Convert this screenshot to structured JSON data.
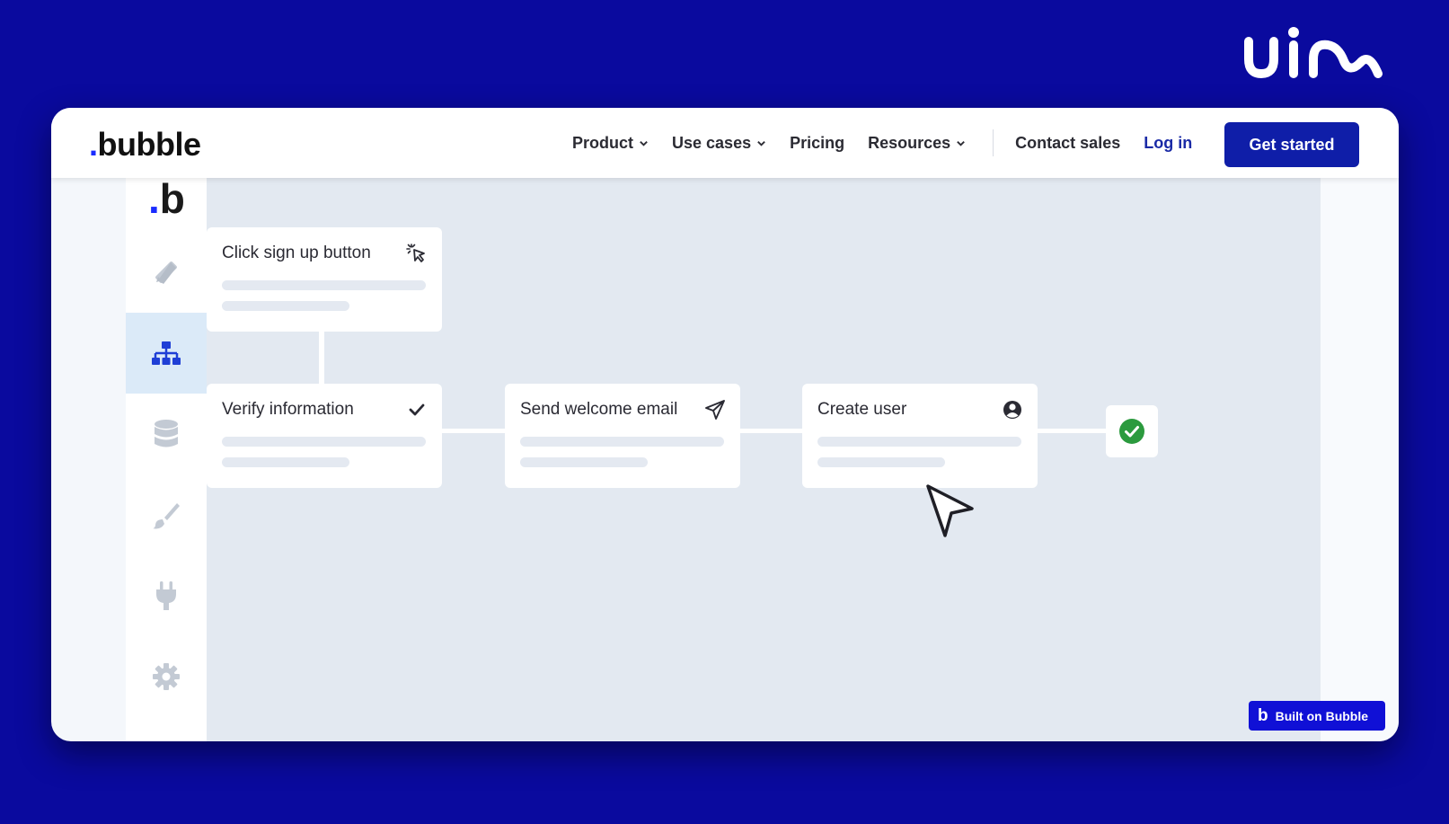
{
  "colors": {
    "page_bg": "#0a0a9e",
    "brand_blue": "#0f1ea8",
    "accent_dot": "#1a2cff",
    "success": "#2b9a3e"
  },
  "navbar": {
    "brand": "bubble",
    "items": [
      {
        "label": "Product",
        "has_dropdown": true
      },
      {
        "label": "Use cases",
        "has_dropdown": true
      },
      {
        "label": "Pricing",
        "has_dropdown": false
      },
      {
        "label": "Resources",
        "has_dropdown": true
      }
    ],
    "contact": "Contact sales",
    "login": "Log in",
    "cta": "Get started"
  },
  "sidebar": {
    "logo": "b",
    "items": [
      {
        "icon": "design-pencil-ruler-icon",
        "active": false
      },
      {
        "icon": "workflow-sitemap-icon",
        "active": true
      },
      {
        "icon": "database-icon",
        "active": false
      },
      {
        "icon": "paintbrush-icon",
        "active": false
      },
      {
        "icon": "plug-icon",
        "active": false
      },
      {
        "icon": "gear-icon",
        "active": false
      }
    ]
  },
  "workflow": {
    "nodes": [
      {
        "title": "Click sign up button",
        "icon": "click-cursor-icon"
      },
      {
        "title": "Verify information",
        "icon": "checkmark-icon"
      },
      {
        "title": "Send welcome email",
        "icon": "paper-plane-icon"
      },
      {
        "title": "Create user",
        "icon": "user-circle-icon"
      }
    ],
    "final_status": "success-check-icon"
  },
  "badge": {
    "label": "Built on Bubble",
    "mark": "b"
  }
}
